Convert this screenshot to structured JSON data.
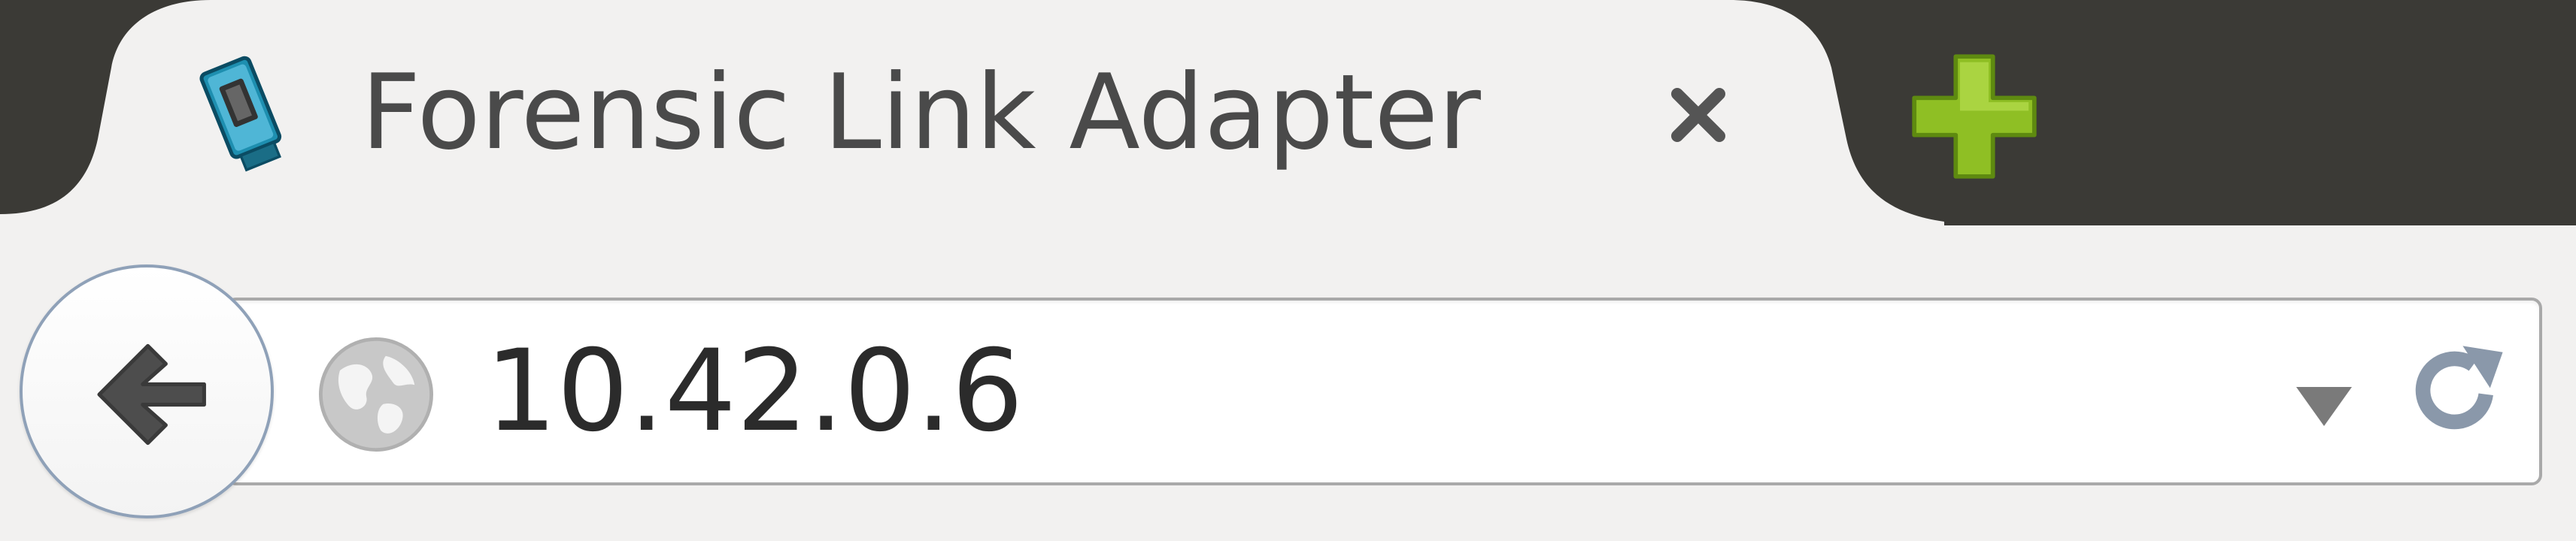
{
  "tab": {
    "title": "Forensic Link Adapter",
    "favicon": "usb-adapter-icon",
    "close_icon": "close-icon"
  },
  "new_tab": {
    "icon": "plus-icon",
    "color": "#8fbf24"
  },
  "nav": {
    "back_icon": "back-arrow-icon",
    "site_icon": "globe-icon",
    "url": "10.42.0.6",
    "dropdown_icon": "dropdown-arrow-icon",
    "reload_icon": "reload-icon"
  },
  "colors": {
    "chrome_dark": "#3b3a36",
    "tab_background": "#f2f1f0",
    "accent_blue": "#8fa1b8"
  }
}
